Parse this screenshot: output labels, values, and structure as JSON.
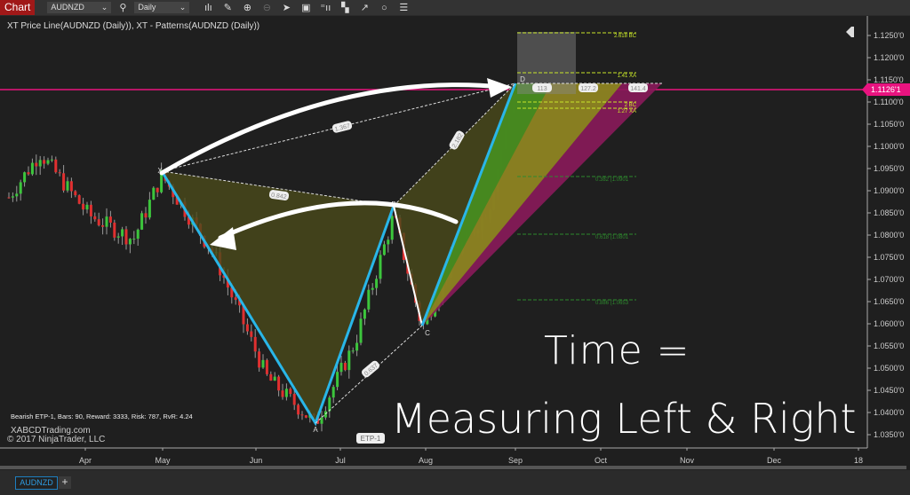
{
  "toolbar": {
    "chart_label": "Chart",
    "instrument": "AUDNZD",
    "interval": "Daily",
    "icons": [
      "search-icon",
      "bar-type-icon",
      "pencil-icon",
      "zoom-in-icon",
      "zoom-out-icon",
      "pointer-icon",
      "data-box-icon",
      "indicators-icon",
      "strategies-icon",
      "drawing-tools-icon",
      "circle-icon",
      "properties-icon"
    ]
  },
  "chart": {
    "title": "XT Price Line(AUDNZD (Daily)), XT - Patterns(AUDNZD (Daily))",
    "stats": "Bearish ETP-1, Bars: 90, Reward: 3333, Risk: 787, RvR: 4.24",
    "brand_line1": "XABCDTrading.com",
    "brand_line2": "© 2017 NinjaTrader, LLC",
    "price_ticks": [
      "1.1250'0",
      "1.1200'0",
      "1.1150'0",
      "1.1100'0",
      "1.1050'0",
      "1.1000'0",
      "1.0950'0",
      "1.0900'0",
      "1.0850'0",
      "1.0800'0",
      "1.0750'0",
      "1.0700'0",
      "1.0650'0",
      "1.0600'0",
      "1.0550'0",
      "1.0500'0",
      "1.0450'0",
      "1.0400'0",
      "1.0350'0"
    ],
    "date_ticks": [
      "Apr",
      "May",
      "Jun",
      "Jul",
      "Aug",
      "Sep",
      "Oct",
      "Nov",
      "Dec",
      "18"
    ],
    "current_price": "1.1126'1",
    "price_line_color": "#e8137f",
    "points": {
      "X": "X",
      "A": "A",
      "B": "B",
      "C": "C",
      "D": "D"
    },
    "ratios": {
      "xd": "1.367",
      "xb": "0.842",
      "bd": "2.182",
      "ac": "0.637"
    },
    "zone_labels": [
      "113",
      "127.2",
      "141.4"
    ],
    "levels": [
      "2.618 BC",
      "1.41 XA",
      "2 BC",
      "1.27 XA"
    ],
    "fib_levels": [
      "0.382 (1.0901",
      "0.618 (1.0801",
      "0.886 (1.0653"
    ],
    "pattern_tag": "ETP-1",
    "colors": {
      "leg": "#29b6e8",
      "up": "#3cc63c",
      "down": "#e03030",
      "fill": "#4a4a1a",
      "zone_green": "#3f8a1f",
      "zone_yellow": "#8a8a1c",
      "zone_magenta": "#8a1a5a"
    }
  },
  "annotation": {
    "line1": "Time =",
    "line2": "Measuring Left & Right"
  },
  "tabs": {
    "active": "AUDNZD",
    "add": "+"
  }
}
